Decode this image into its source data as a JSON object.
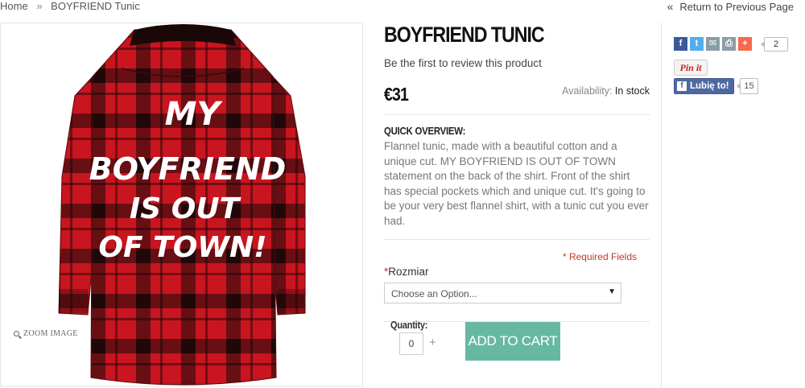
{
  "breadcrumb": {
    "home": "Home",
    "separator": "»",
    "current": "BOYFRIEND Tunic"
  },
  "return_link": {
    "arrow": "«",
    "label": "Return to Previous Page"
  },
  "image": {
    "shirt_text": [
      "MY",
      "BOYFRIEND",
      "IS OUT",
      "OF TOWN!"
    ],
    "zoom_label": "ZOOM IMAGE",
    "zoom_icon": "magnifier-icon"
  },
  "product": {
    "title": "BOYFRIEND TUNIC",
    "review_link": "Be the first to review this product",
    "price": "€31",
    "availability_label": "Availability:",
    "availability_value": "In stock",
    "quick_overview_label": "QUICK OVERVIEW:",
    "quick_overview_text": "Flannel tunic, made with a beautiful cotton and a unique cut. MY BOYFRIEND IS OUT OF TOWN statement on the back of the shirt. Front of the shirt has special pockets which and unique cut. It's going to be your very best flannel shirt, with a tunic cut you ever had.",
    "required_fields": "* Required Fields",
    "option_required_mark": "*",
    "option_label": "Rozmiar",
    "option_placeholder": "Choose an Option...",
    "quantity_label": "Quantity:",
    "quantity_value": "0",
    "quantity_plus": "+",
    "add_to_cart": "ADD TO CART"
  },
  "social": {
    "share_icons": [
      {
        "icon": "facebook-icon",
        "glyph": "f",
        "color": "#3b5998"
      },
      {
        "icon": "twitter-icon",
        "glyph": "t",
        "color": "#55acee"
      },
      {
        "icon": "email-icon",
        "glyph": "✉",
        "color": "#8a9da8"
      },
      {
        "icon": "print-icon",
        "glyph": "⎙",
        "color": "#8a9da8"
      },
      {
        "icon": "plus-icon",
        "glyph": "+",
        "color": "#f8694d"
      }
    ],
    "share_count": "2",
    "pin_it": "Pin it",
    "fb_like_label": "Lubię to!",
    "fb_like_count": "15"
  },
  "colors": {
    "accent_button": "#66b9a0",
    "required": "#c0392b",
    "shirt_red": "#c8151f"
  }
}
